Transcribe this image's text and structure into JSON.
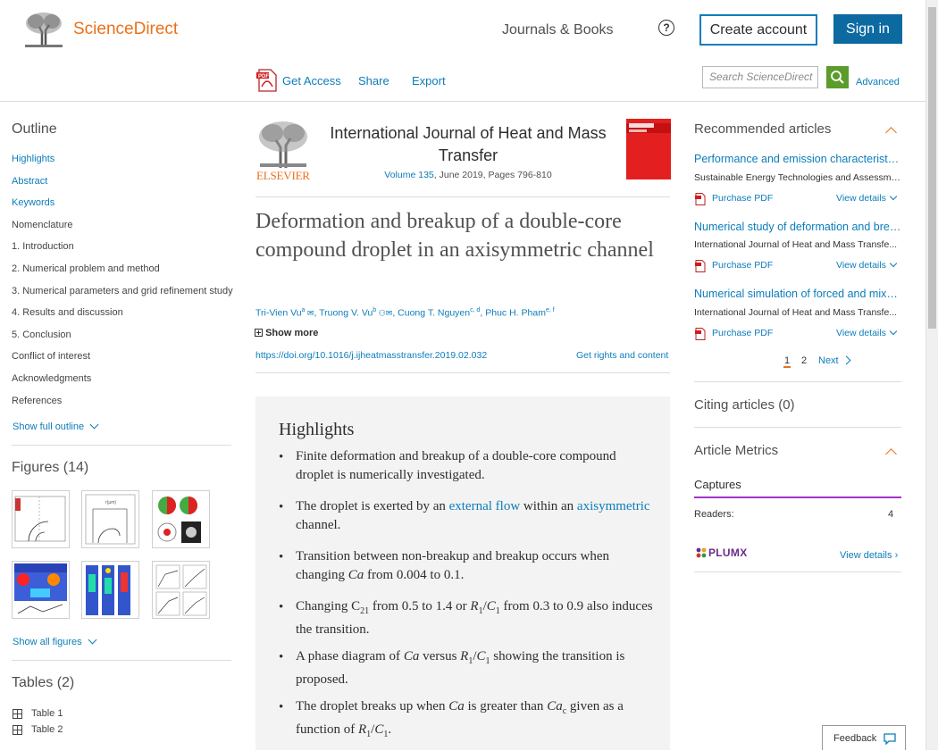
{
  "header": {
    "brand": "ScienceDirect",
    "journals_books": "Journals & Books",
    "help_icon": "?",
    "create_account": "Create account",
    "sign_in": "Sign in"
  },
  "toolbar": {
    "get_access": "Get Access",
    "share": "Share",
    "export": "Export",
    "search_placeholder": "Search ScienceDirect",
    "advanced": "Advanced"
  },
  "outline": {
    "title": "Outline",
    "items": [
      {
        "label": "Highlights"
      },
      {
        "label": "Abstract"
      },
      {
        "label": "Keywords"
      },
      {
        "label": "Nomenclature"
      },
      {
        "label": "1. Introduction"
      },
      {
        "label": "2. Numerical problem and method"
      },
      {
        "label": "3. Numerical parameters and grid refinement study"
      },
      {
        "label": "4. Results and discussion"
      },
      {
        "label": "5. Conclusion"
      },
      {
        "label": "Conflict of interest"
      },
      {
        "label": "Acknowledgments"
      },
      {
        "label": "References"
      }
    ],
    "show_full": "Show full outline"
  },
  "figures": {
    "title": "Figures (14)",
    "show_all": "Show all figures"
  },
  "tables": {
    "title": "Tables (2)",
    "items": [
      "Table 1",
      "Table 2"
    ]
  },
  "article": {
    "journal": "International Journal of Heat and Mass Transfer",
    "volume_link": "Volume 135",
    "volume_rest": ", June 2019, Pages 796-810",
    "publisher": "ELSEVIER",
    "title": "Deformation and breakup of a double-core compound droplet in an axisymmetric channel",
    "authors": [
      {
        "name": "Tri-Vien Vu",
        "sup": "a"
      },
      {
        "name": "Truong V. Vu",
        "sup": "b"
      },
      {
        "name": "Cuong T. Nguyen",
        "sup": "c, d"
      },
      {
        "name": "Phuc H. Pham",
        "sup": "e, f"
      }
    ],
    "show_more": "Show more",
    "doi": "https://doi.org/10.1016/j.ijheatmasstransfer.2019.02.032",
    "rights": "Get rights and content"
  },
  "highlights": {
    "title": "Highlights",
    "items": [
      "Finite deformation and breakup of a double-core compound droplet is numerically investigated.",
      "The droplet is exerted by an external flow within an axisymmetric channel.",
      "Transition between non-breakup and breakup occurs when changing Ca from 0.004 to 0.1.",
      "Changing C21 from 0.5 to 1.4 or R1/C1 from 0.3 to 0.9 also induces the transition.",
      "A phase diagram of Ca versus R1/C1 showing the transition is proposed.",
      "The droplet breaks up when Ca is greater than Cac given as a function of R1/C1."
    ]
  },
  "recommended": {
    "title": "Recommended articles",
    "articles": [
      {
        "title": "Performance and emission characteristics of...",
        "source": "Sustainable Energy Technologies and Assessme...",
        "purchase": "Purchase PDF",
        "view": "View details"
      },
      {
        "title": "Numerical study of deformation and breakup...",
        "source": "International Journal of Heat and Mass Transfe...",
        "purchase": "Purchase PDF",
        "view": "View details"
      },
      {
        "title": "Numerical simulation of forced and mixed...",
        "source": "International Journal of Heat and Mass Transfe...",
        "purchase": "Purchase PDF",
        "view": "View details"
      }
    ],
    "pages": [
      "1",
      "2"
    ],
    "next": "Next"
  },
  "citing": {
    "title": "Citing articles (0)"
  },
  "metrics": {
    "title": "Article Metrics",
    "captures": "Captures",
    "readers_label": "Readers:",
    "readers_value": "4",
    "plumx": "PLUMX",
    "view_details": "View details"
  },
  "feedback": "Feedback",
  "colors": {
    "accent": "#e9711c",
    "link": "#0c7dbb",
    "signin": "#0c6aa1",
    "search": "#5c9c2c"
  },
  "icons": [
    "elsevier-tree-logo",
    "help-icon",
    "pdf-icon",
    "search-icon",
    "chevron-up-icon",
    "chevron-down-icon",
    "grid-table-icon",
    "feedback-bubble-icon"
  ]
}
